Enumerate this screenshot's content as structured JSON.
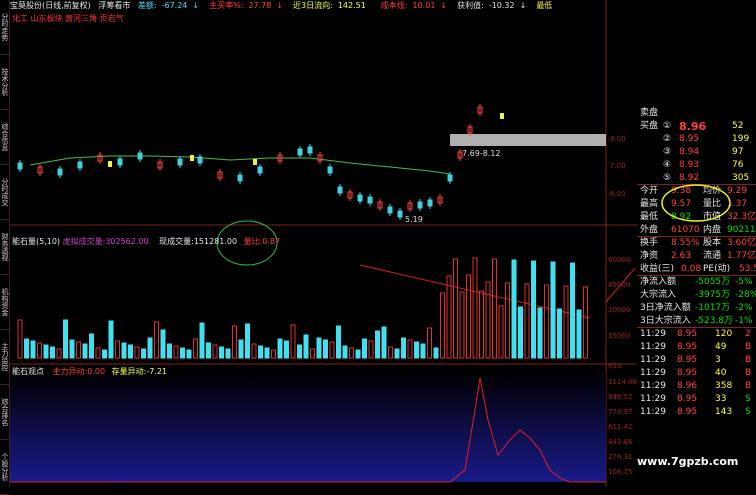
{
  "header": {
    "stock": "宝莫股份(日线,前复权)",
    "indicator": "浮筹看市",
    "items": [
      {
        "label": "差额:",
        "value": "-67.24",
        "arrow": "↓",
        "color": "#40e0ff"
      },
      {
        "label": "主买率%:",
        "value": "27.78",
        "arrow": "↓",
        "color": "#ff4040"
      },
      {
        "label": "近3日流向:",
        "value": "142.51",
        "arrow": "",
        "color": "#ffff40"
      },
      {
        "label": "成本线:",
        "value": "10.01",
        "arrow": "↓",
        "color": "#ff4040"
      },
      {
        "label": "获利值:",
        "value": "-10.32",
        "arrow": "↓",
        "color": "#e0e0e0"
      },
      {
        "label": "最低",
        "value": "",
        "arrow": "",
        "color": "#ffff40"
      }
    ],
    "concepts": "化工 山东板块 黄河三角 页岩气"
  },
  "side_tabs": [
    "分时走势",
    "技术分析",
    "综合信息",
    "分时成交",
    "财务透视",
    "机构资金",
    "主力监控",
    "综合排名",
    "个股分析"
  ],
  "chart": {
    "range_label": "7.69-8.12",
    "low_label": "5.19",
    "price_axis": [
      "8.00",
      "7.00",
      "6.00"
    ],
    "vol_axis": [
      "60000",
      "45000",
      "30000",
      "15000"
    ],
    "ind_axis": [
      "1114.08",
      "946.52",
      "778.97",
      "611.42",
      "443.86",
      "276.31",
      "108.75"
    ],
    "x10": "X10"
  },
  "volume_header": {
    "title": "能石量(5,10)",
    "item1_label": "虚拟成交量:",
    "item1_value": "302562.00",
    "item2_label": "现成交量:",
    "item2_value": "151281.00",
    "item3_label": "量比:",
    "item3_value": "0.87"
  },
  "indicator_header": {
    "title": "能石观点",
    "item1_label": "主力异动:",
    "item1_value": "0.00",
    "item2_label": "存量异动:",
    "item2_value": "-7.21"
  },
  "quote": {
    "sell_label": "卖盘",
    "buys": [
      {
        "label": "买盘",
        "no": "①",
        "price": "8.96",
        "vol": "52"
      },
      {
        "label": "",
        "no": "②",
        "price": "8.95",
        "vol": "199"
      },
      {
        "label": "",
        "no": "③",
        "price": "8.94",
        "vol": "97"
      },
      {
        "label": "",
        "no": "④",
        "price": "8.93",
        "vol": "76"
      },
      {
        "label": "",
        "no": "⑤",
        "price": "8.92",
        "vol": "305"
      }
    ],
    "stats": [
      {
        "l1": "今开",
        "v1": "9.38",
        "l2": "均价",
        "v2": "9.29"
      },
      {
        "l1": "最高",
        "v1": "9.57",
        "l2": "量比",
        "v2": "1.37"
      },
      {
        "l1": "最低",
        "v1": "8.92",
        "l2": "市值",
        "v2": "32.3亿"
      },
      {
        "l1": "外盘",
        "v1": "61070",
        "l2": "内盘",
        "v2": "90211"
      },
      {
        "l1": "换手",
        "v1": "8.55%",
        "l2": "股本",
        "v2": "3.60亿"
      },
      {
        "l1": "净资",
        "v1": "2.63",
        "l2": "流通",
        "v2": "1.77亿"
      },
      {
        "l1": "收益(三)",
        "v1": "0.08",
        "l2": "PE(动)",
        "v2": "53.5"
      }
    ],
    "flows": [
      {
        "label": "净流入额",
        "v1": "-5055万",
        "v2": "-5%"
      },
      {
        "label": "大宗流入",
        "v1": "-3975万",
        "v2": "-28%"
      },
      {
        "label": "3日净流入额",
        "v1": "-1017万",
        "v2": "-2%"
      },
      {
        "label": "3日大宗流入",
        "v1": "-523.8万",
        "v2": "-1%"
      }
    ],
    "ticks": [
      {
        "t": "11:29",
        "p": "8.95",
        "v": "120",
        "s": "2"
      },
      {
        "t": "11:29",
        "p": "8.95",
        "v": "49",
        "s": "B"
      },
      {
        "t": "11:29",
        "p": "8.95",
        "v": "3",
        "s": "B"
      },
      {
        "t": "11:29",
        "p": "8.95",
        "v": "40",
        "s": "B"
      },
      {
        "t": "11:29",
        "p": "8.96",
        "v": "358",
        "s": "B"
      },
      {
        "t": "11:29",
        "p": "8.95",
        "v": "33",
        "s": "S"
      },
      {
        "t": "11:29",
        "p": "8.95",
        "v": "143",
        "s": "S"
      }
    ]
  },
  "watermark": "www.7gpzb.com"
}
